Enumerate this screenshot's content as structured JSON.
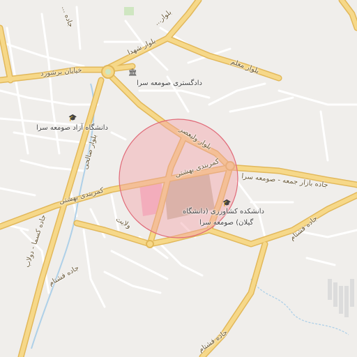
{
  "map": {
    "colors": {
      "background": "#f0eeeb",
      "major_road": "#f6d889",
      "major_road_casing": "#e2b85a",
      "minor_road": "#ffffff",
      "minor_road_casing": "#d8d5d0",
      "highlight_fill": "#f1a1a8",
      "campus_gray": "#c8bfa9",
      "campus_pink": "#f4b7cc",
      "water_line": "#aed0e8"
    },
    "icons": {
      "monument": "monument-icon",
      "education": "graduation-cap-icon"
    },
    "labels": {
      "bolvar_shohada": "بلوار شهدا",
      "bolvar_moallem": "بلوار معلم",
      "khiaban_barshvord": "خیابان برشورد",
      "dadgostari": "دادگستری صومعه سرا",
      "azad_university": "دانشگاه آزاد صومعه سرا",
      "bolvar_valiasr": "بلوار ولیعصر",
      "kamarbandi_beheshti_north": "کمربندی بهشتی",
      "kamarbandi_beheshti_west": "کمربندی بهشتی",
      "jadde_jome_bazar": "جاده بازار جمعه - صومعه سرا",
      "bolvar_salehi": "بلوار صالحی",
      "velayat": "ولایت",
      "jadde_gil_dolab": "جاده کسما - دولاب",
      "jadde_fashtam_west": "جاده فشتام",
      "jadde_fashtam_east": "جاده فشتام",
      "jadde_fashtam_south": "جاده فشتام",
      "keshavarzi_line1": "دانشکده کشاورزی (دانشگاه",
      "keshavarzi_line2": "گیلان) صومعه سرا",
      "top_left_road": "جاده ...",
      "top_mid_road": "بلوار..."
    }
  }
}
